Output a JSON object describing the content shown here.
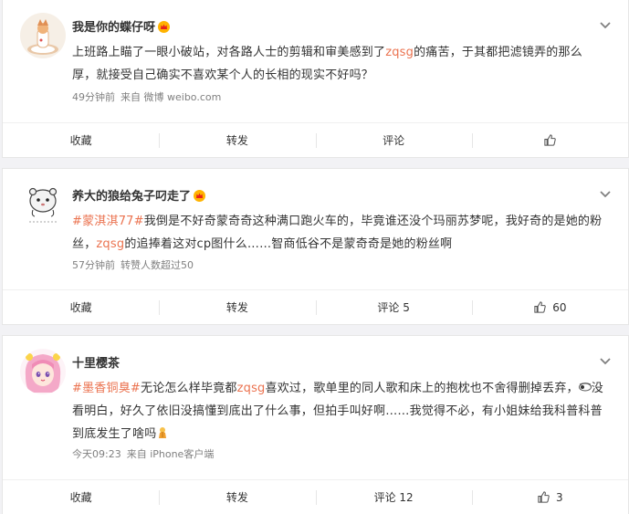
{
  "posts": [
    {
      "username": "我是你的蝶仔呀",
      "text": [
        {
          "t": "上班路上瞄了一眼小破站，对各路人士的剪辑和审美感到了"
        },
        {
          "t": "zqsg",
          "link": true
        },
        {
          "t": "的痛苦，于其都把滤镜弄的那么厚，就接受自己确实不喜欢某个人的长相的现实不好吗？"
        }
      ],
      "meta": [
        "49分钟前",
        "来自 微博 weibo.com"
      ],
      "actions": {
        "collect": "收藏",
        "repost": "转发",
        "comment": "评论",
        "like_count": ""
      }
    },
    {
      "username": "养大的狼给兔子叼走了",
      "text": [
        {
          "t": "#蒙淇淇77#",
          "link": true
        },
        {
          "t": "我倒是不好奇蒙奇奇这种满口跑火车的，毕竟谁还没个玛丽苏梦呢，我好奇的是她的粉丝，"
        },
        {
          "t": "zqsg",
          "link": true
        },
        {
          "t": "的追捧着这对cp图什么……智商低谷不是蒙奇奇是她的粉丝啊"
        }
      ],
      "meta": [
        "57分钟前",
        "转赞人数超过50"
      ],
      "actions": {
        "collect": "收藏",
        "repost": "转发",
        "comment": "评论 5",
        "like_count": "60"
      }
    },
    {
      "username": "十里樱茶",
      "text": [
        {
          "t": "#墨香铜臭#",
          "link": true
        },
        {
          "t": "无论怎么样毕竟都"
        },
        {
          "t": "zqsg",
          "link": true
        },
        {
          "t": "喜欢过，歌单里的同人歌和床上的抱枕也不舍得删掉丢弃，"
        },
        {
          "t": "😒",
          "emoji": "eyes"
        },
        {
          "t": "没看明白，好久了依旧没搞懂到底出了什么事，但拍手叫好啊……我觉得不必，有小姐妹给我科普科普到底发生了啥吗"
        },
        {
          "t": "🙏",
          "emoji": "pray"
        }
      ],
      "meta": [
        "今天09:23",
        "来自 iPhone客户端"
      ],
      "actions": {
        "collect": "收藏",
        "repost": "转发",
        "comment": "评论 12",
        "like_count": "3"
      }
    }
  ],
  "colors": {
    "link": "#eb7350",
    "meta": "#808080",
    "bg": "#f2f2f5"
  },
  "icons": {
    "vip": "crown-badge-icon",
    "menu": "chevron-down-icon",
    "like": "thumbs-up-icon"
  }
}
